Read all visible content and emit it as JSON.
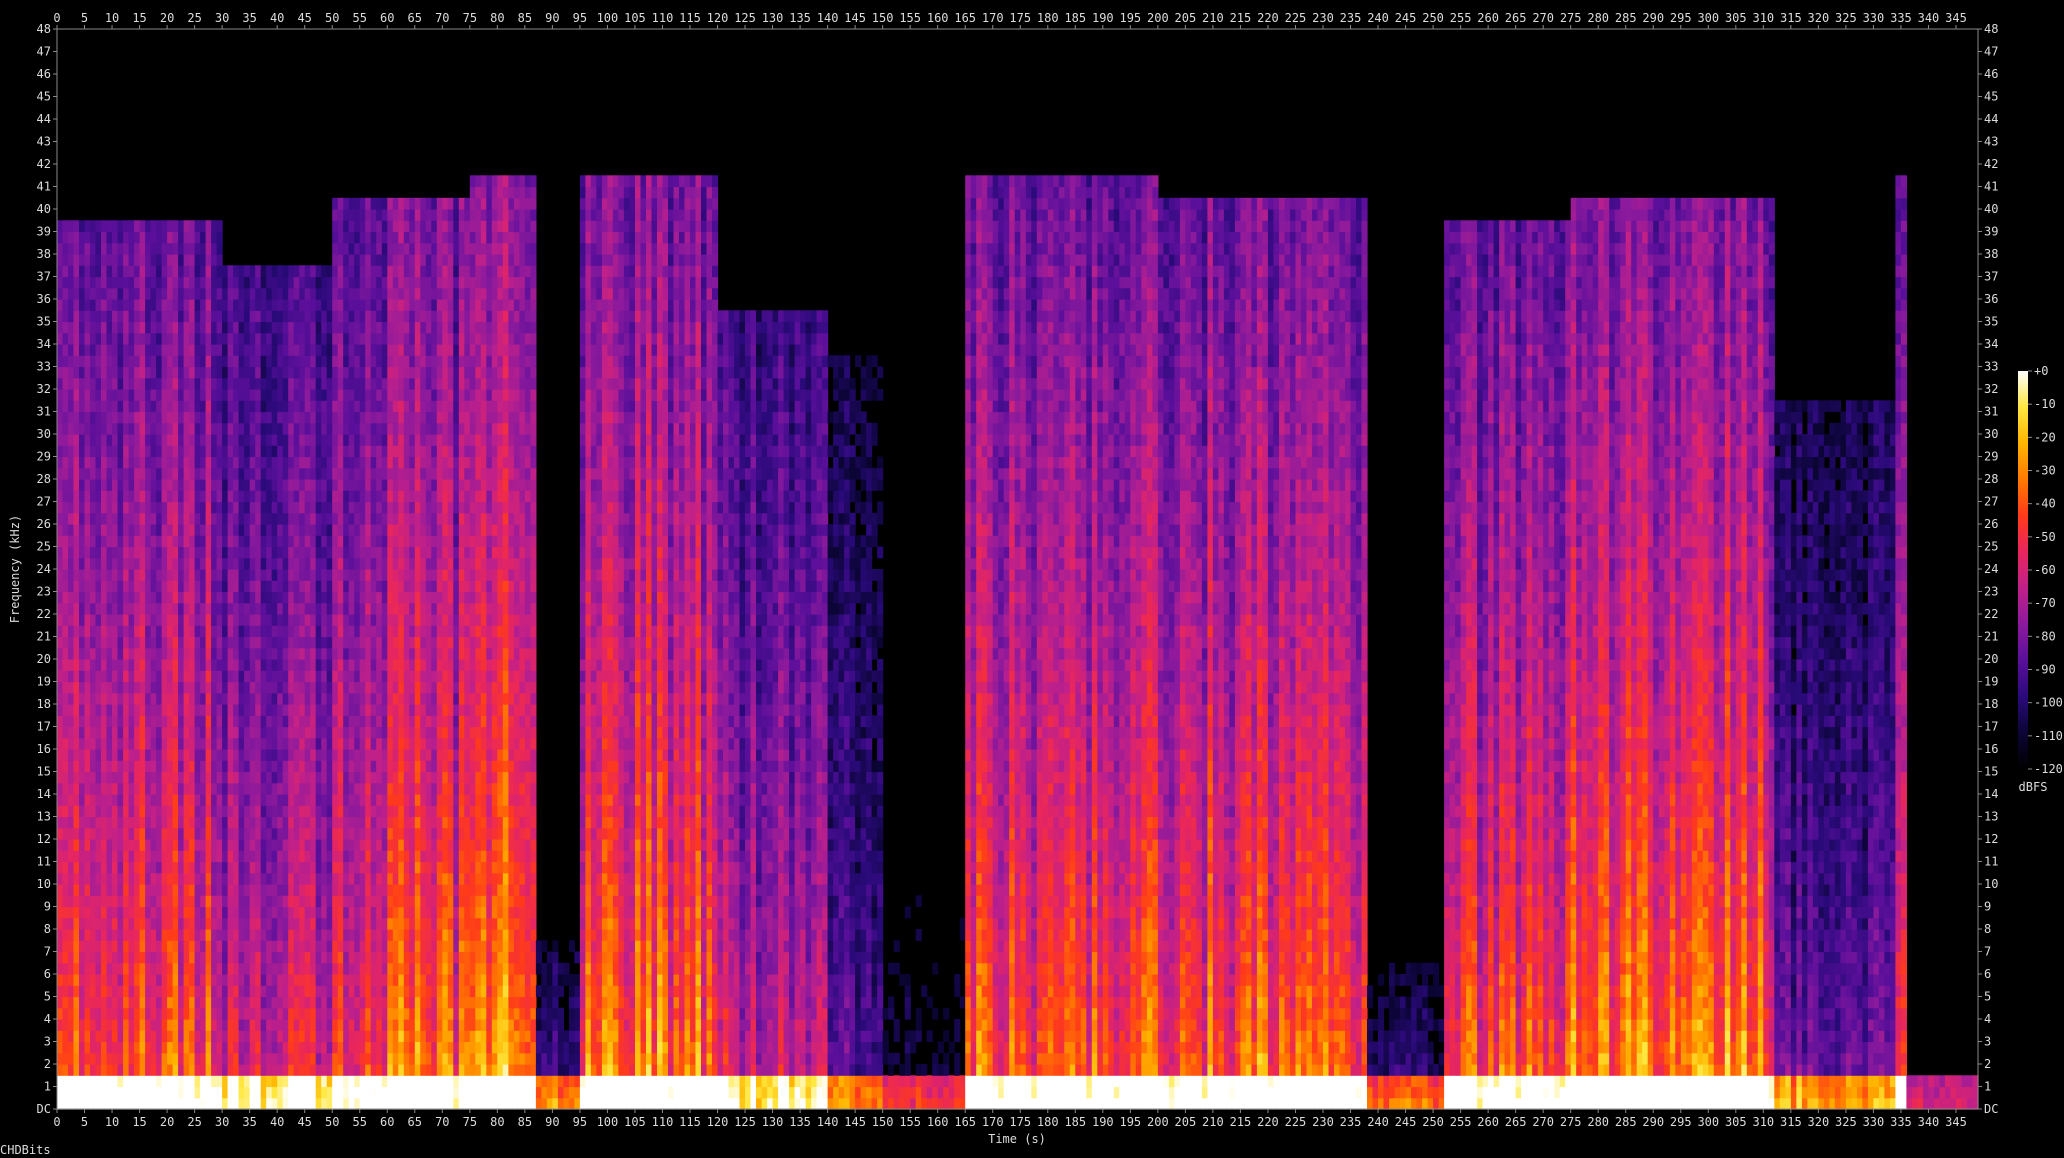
{
  "chart_data": {
    "type": "heatmap",
    "title": "",
    "xlabel": "Time (s)",
    "ylabel": "Frequency (kHz)",
    "xlim": [
      0,
      349
    ],
    "ylim": [
      0,
      48
    ],
    "x_ticks": [
      "0",
      "5",
      "10",
      "15",
      "20",
      "25",
      "30",
      "35",
      "40",
      "45",
      "50",
      "55",
      "60",
      "65",
      "70",
      "75",
      "80",
      "85",
      "90",
      "95",
      "100",
      "105",
      "110",
      "115",
      "120",
      "125",
      "130",
      "135",
      "140",
      "145",
      "150",
      "155",
      "160",
      "165",
      "170",
      "175",
      "180",
      "185",
      "190",
      "195",
      "200",
      "205",
      "210",
      "215",
      "220",
      "225",
      "230",
      "235",
      "240",
      "245",
      "250",
      "255",
      "260",
      "265",
      "270",
      "275",
      "280",
      "285",
      "290",
      "295",
      "300",
      "305",
      "310",
      "315",
      "320",
      "325",
      "330",
      "335",
      "340",
      "345"
    ],
    "y_ticks": [
      "DC",
      "1",
      "2",
      "3",
      "4",
      "5",
      "6",
      "7",
      "8",
      "9",
      "10",
      "11",
      "12",
      "13",
      "14",
      "15",
      "16",
      "17",
      "18",
      "19",
      "20",
      "21",
      "22",
      "23",
      "24",
      "25",
      "26",
      "27",
      "28",
      "29",
      "30",
      "31",
      "32",
      "33",
      "34",
      "35",
      "36",
      "37",
      "38",
      "39",
      "40",
      "41",
      "42",
      "43",
      "44",
      "45",
      "46",
      "47",
      "48"
    ],
    "colorbar": {
      "label": "dBFS",
      "ticks": [
        "+0",
        "-10",
        "-20",
        "-30",
        "-40",
        "-50",
        "-60",
        "-70",
        "-80",
        "-90",
        "-100",
        "-110",
        "-120"
      ],
      "range": [
        -120,
        0
      ],
      "colors": [
        "#000000",
        "#0b0535",
        "#2a0a7a",
        "#5a0f9a",
        "#8c1a9c",
        "#c0208a",
        "#e8265e",
        "#ff3a1a",
        "#ff7a00",
        "#ffb400",
        "#ffe840",
        "#ffffff"
      ]
    },
    "energy_profile": {
      "description_units": "relative spectral brightness per time segment (0-1), max frequency reached in kHz",
      "segments": [
        {
          "t": [
            0,
            30
          ],
          "energy": 0.75,
          "top_khz": 38
        },
        {
          "t": [
            30,
            50
          ],
          "energy": 0.6,
          "top_khz": 36
        },
        {
          "t": [
            50,
            75
          ],
          "energy": 0.8,
          "top_khz": 39
        },
        {
          "t": [
            75,
            87
          ],
          "energy": 0.9,
          "top_khz": 40
        },
        {
          "t": [
            87,
            95
          ],
          "energy": 0.35,
          "top_khz": 6
        },
        {
          "t": [
            95,
            120
          ],
          "energy": 0.85,
          "top_khz": 40
        },
        {
          "t": [
            120,
            140
          ],
          "energy": 0.6,
          "top_khz": 34
        },
        {
          "t": [
            140,
            150
          ],
          "energy": 0.35,
          "top_khz": 32
        },
        {
          "t": [
            150,
            165
          ],
          "energy": 0.2,
          "top_khz": 8
        },
        {
          "t": [
            165,
            200
          ],
          "energy": 0.8,
          "top_khz": 40
        },
        {
          "t": [
            200,
            238
          ],
          "energy": 0.8,
          "top_khz": 39
        },
        {
          "t": [
            238,
            252
          ],
          "energy": 0.3,
          "top_khz": 5
        },
        {
          "t": [
            252,
            275
          ],
          "energy": 0.75,
          "top_khz": 38
        },
        {
          "t": [
            275,
            312
          ],
          "energy": 0.85,
          "top_khz": 39
        },
        {
          "t": [
            312,
            334
          ],
          "energy": 0.4,
          "top_khz": 30
        },
        {
          "t": [
            334,
            336
          ],
          "energy": 0.9,
          "top_khz": 40
        },
        {
          "t": [
            336,
            349
          ],
          "energy": 0.1,
          "top_khz": 1
        }
      ]
    }
  },
  "footer": {
    "text": "CHDBits"
  }
}
